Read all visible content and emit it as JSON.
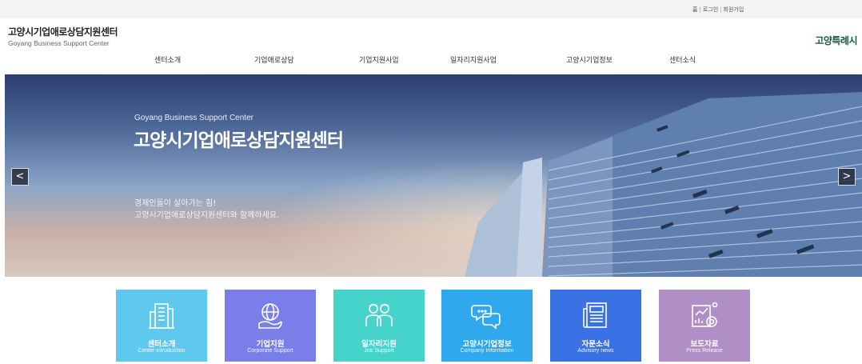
{
  "topbar": {
    "links": [
      "홈",
      "로그인",
      "회원가입"
    ]
  },
  "logo": {
    "name_ko": "고양시기업애로상담지원센터",
    "name_en": "Goyang Business Support Center"
  },
  "city_logo": "고양특례시",
  "nav": [
    "센터소개",
    "기업애로상담",
    "기업지원사업",
    "일자리지원사업",
    "고양시기업정보",
    "센터소식"
  ],
  "hero": {
    "eyebrow": "Goyang Business Support Center",
    "headline": "고양시기업애로상담지원센터",
    "sub_line1": "경제인들이 살아가는 힘!",
    "sub_line2": "고양시기업애로상담지원센터와 함께하세요.",
    "prev": "<",
    "next": ">"
  },
  "tiles": [
    {
      "title": "센터소개",
      "subtitle": "Center introduction",
      "color": "#5ec8ee",
      "icon": "building-icon"
    },
    {
      "title": "기업지원",
      "subtitle": "Corporate Support",
      "color": "#7a7ee8",
      "icon": "globe-hand-icon"
    },
    {
      "title": "일자리지원",
      "subtitle": "Job Support",
      "color": "#45d3cc",
      "icon": "workers-icon"
    },
    {
      "title": "고양시기업정보",
      "subtitle": "Company Information",
      "color": "#2fa8ee",
      "icon": "chat-bubbles-icon"
    },
    {
      "title": "자문소식",
      "subtitle": "Advisory news",
      "color": "#3a72e6",
      "icon": "newspaper-icon"
    },
    {
      "title": "보도자료",
      "subtitle": "Press Release",
      "color": "#b08ec6",
      "icon": "report-icon"
    }
  ]
}
